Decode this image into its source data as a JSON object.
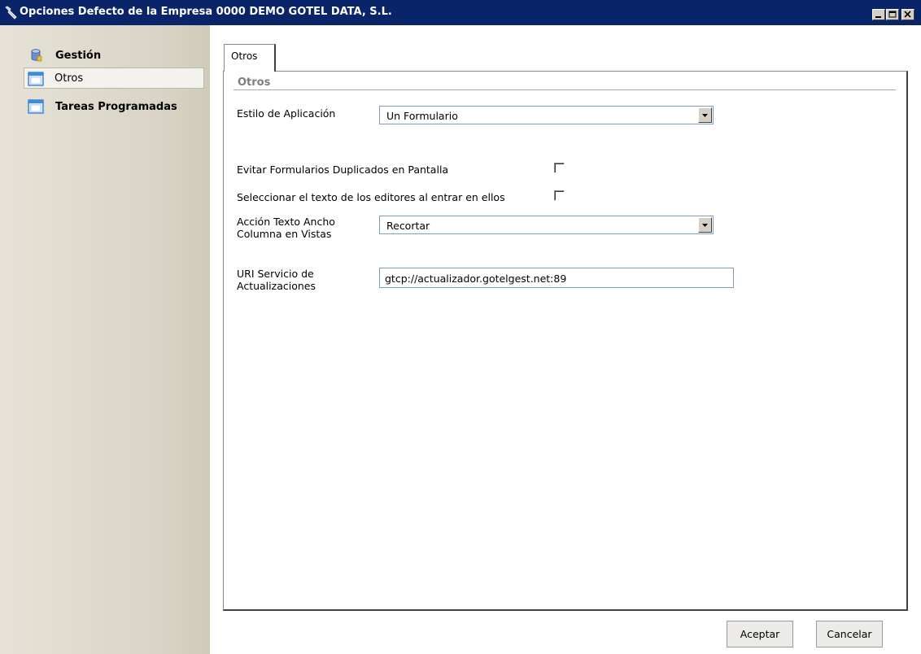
{
  "window": {
    "title": "Opciones Defecto de la Empresa 0000 DEMO GOTEL DATA, S.L.",
    "icon": "wrench-icon"
  },
  "sidebar": {
    "items": [
      {
        "label": "Gestión",
        "icon": "database-icon",
        "bold": true,
        "selected": false
      },
      {
        "label": "Otros",
        "icon": "window-icon",
        "bold": false,
        "selected": true
      },
      {
        "label": "Tareas Programadas",
        "icon": "window-icon",
        "bold": true,
        "selected": false
      }
    ]
  },
  "tabs": [
    {
      "label": "Otros",
      "active": true
    }
  ],
  "group": {
    "title": "Otros"
  },
  "form": {
    "estilo": {
      "label": "Estilo de Aplicación",
      "value": "Un Formulario"
    },
    "evitar": {
      "label": "Evitar Formularios Duplicados en Pantalla",
      "checked": false
    },
    "seleccionar": {
      "label": "Seleccionar el texto de los editores al entrar en ellos",
      "checked": false
    },
    "accion": {
      "label_line1": "Acción Texto Ancho",
      "label_line2": "Columna en Vistas",
      "value": "Recortar"
    },
    "uri": {
      "label_line1": "URI Servicio de",
      "label_line2": "Actualizaciones",
      "value": "gtcp://actualizador.gotelgest.net:89"
    }
  },
  "buttons": {
    "accept": "Aceptar",
    "cancel": "Cancelar"
  },
  "colors": {
    "titlebar": "#0a246a",
    "sidebar": "#d8d3c4",
    "field_border": "#7f9db9"
  }
}
